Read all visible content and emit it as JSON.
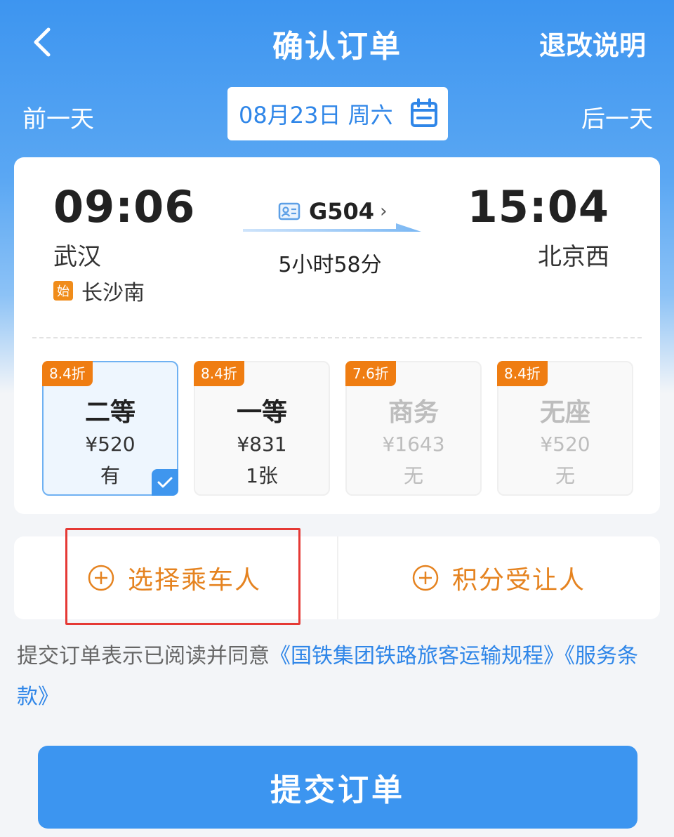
{
  "header": {
    "title": "确认订单",
    "refund_info": "退改说明"
  },
  "date_nav": {
    "prev": "前一天",
    "next": "后一天",
    "date": "08月23日 周六"
  },
  "train": {
    "departure_time": "09:06",
    "arrival_time": "15:04",
    "departure_station": "武汉",
    "arrival_station": "北京西",
    "origin_badge": "始",
    "origin_station": "长沙南",
    "train_number": "G504",
    "duration": "5小时58分"
  },
  "seats": [
    {
      "discount": "8.4折",
      "name": "二等",
      "price": "¥520",
      "availability": "有",
      "selected": true,
      "disabled": false
    },
    {
      "discount": "8.4折",
      "name": "一等",
      "price": "¥831",
      "availability": "1张",
      "selected": false,
      "disabled": false
    },
    {
      "discount": "7.6折",
      "name": "商务",
      "price": "¥1643",
      "availability": "无",
      "selected": false,
      "disabled": true
    },
    {
      "discount": "8.4折",
      "name": "无座",
      "price": "¥520",
      "availability": "无",
      "selected": false,
      "disabled": true
    }
  ],
  "passenger": {
    "select_passenger": "选择乘车人",
    "points_transferee": "积分受让人"
  },
  "agreement": {
    "prefix": "提交订单表示已阅读并同意",
    "rules_link": "《国铁集团铁路旅客运输规程》",
    "terms_link": "《服务条款》"
  },
  "submit_label": "提交订单",
  "colors": {
    "primary": "#3c95f0",
    "accent_orange": "#ef7d12",
    "highlight_red": "#e53935"
  }
}
